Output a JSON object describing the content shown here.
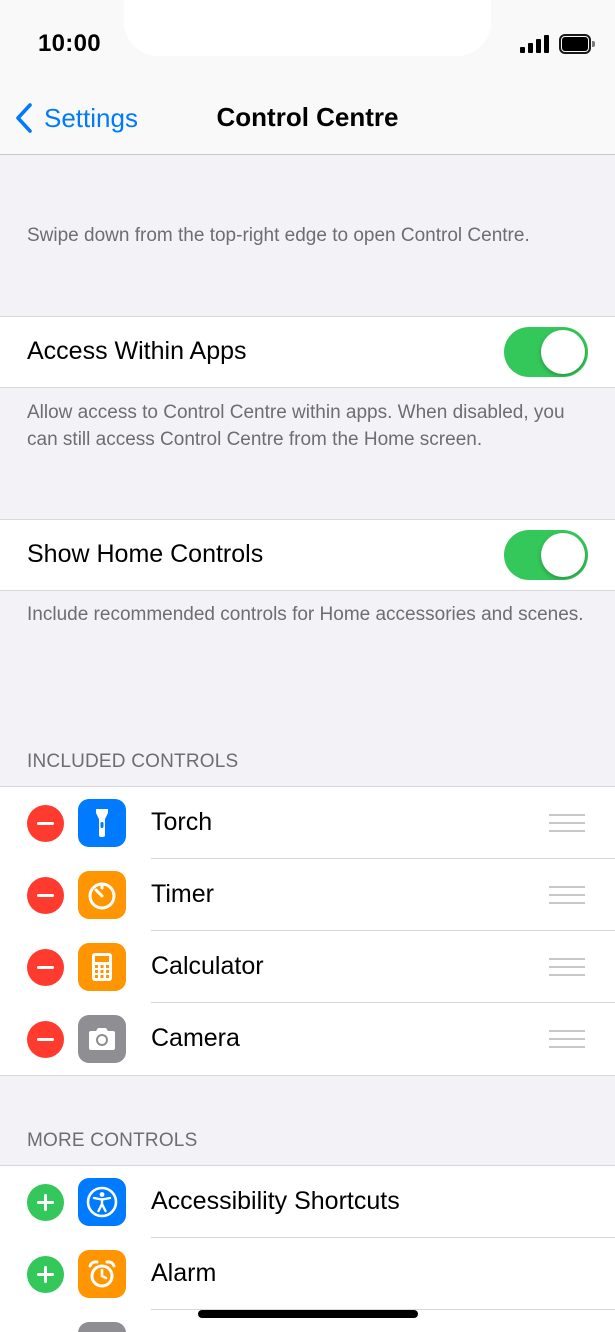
{
  "status_bar": {
    "time": "10:00",
    "signal_icon": "cellular-signal-icon",
    "battery_icon": "battery-full-icon"
  },
  "nav": {
    "back_label": "Settings",
    "back_icon": "chevron-left-icon",
    "title": "Control Centre",
    "accent_color": "#007aff"
  },
  "intro_text": "Swipe down from the top-right edge to open Control Centre.",
  "access_within_apps": {
    "label": "Access Within Apps",
    "enabled": true,
    "footer": "Allow access to Control Centre within apps. When disabled, you can still access Control Centre from the Home screen."
  },
  "show_home_controls": {
    "label": "Show Home Controls",
    "enabled": true,
    "footer": "Include recommended controls for Home accessories and scenes."
  },
  "included_controls": {
    "header": "INCLUDED CONTROLS",
    "items": [
      {
        "label": "Torch",
        "icon": "torch-icon",
        "icon_color": "#007aff"
      },
      {
        "label": "Timer",
        "icon": "timer-icon",
        "icon_color": "#ff9500"
      },
      {
        "label": "Calculator",
        "icon": "calculator-icon",
        "icon_color": "#ff9500"
      },
      {
        "label": "Camera",
        "icon": "camera-icon",
        "icon_color": "#8e8e93"
      }
    ]
  },
  "more_controls": {
    "header": "MORE CONTROLS",
    "items": [
      {
        "label": "Accessibility Shortcuts",
        "icon": "accessibility-icon",
        "icon_color": "#007aff"
      },
      {
        "label": "Alarm",
        "icon": "alarm-clock-icon",
        "icon_color": "#ff9500"
      }
    ]
  },
  "colors": {
    "toggle_on": "#34c759",
    "remove": "#ff3b30",
    "add": "#34c759",
    "secondary_text": "#6d6d72"
  }
}
